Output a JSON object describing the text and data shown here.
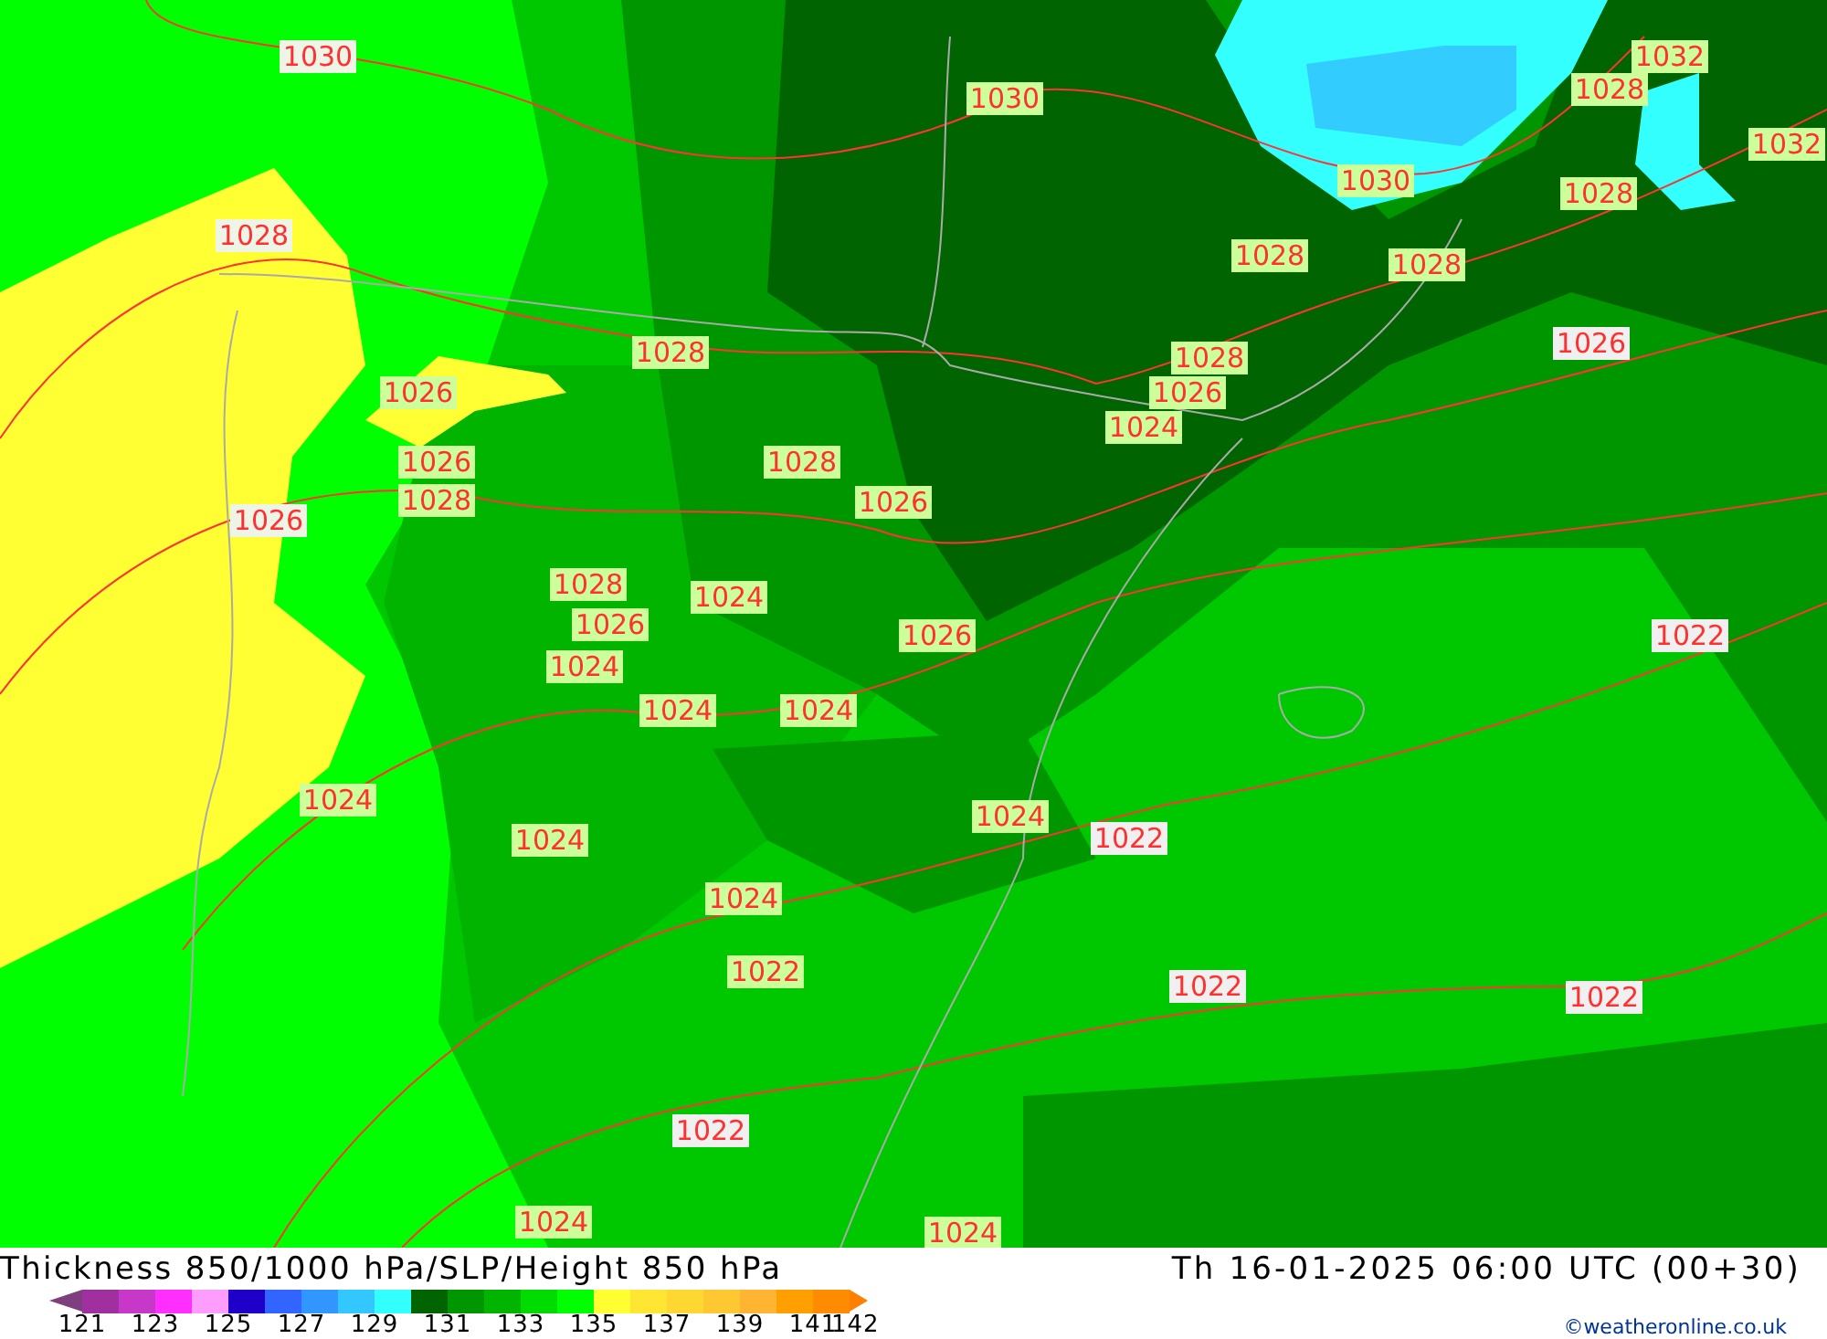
{
  "map": {
    "isobar_labels": [
      {
        "text": "1030",
        "color": "#eef5e6"
      },
      {
        "text": "1030",
        "color": "#ccff99"
      },
      {
        "text": "1032",
        "color": "#ccff99"
      },
      {
        "text": "1028",
        "color": "#ccff99"
      },
      {
        "text": "1032",
        "color": "#ccff99"
      },
      {
        "text": "1030",
        "color": "#ccff99"
      },
      {
        "text": "1028",
        "color": "#ccff99"
      },
      {
        "text": "1028",
        "color": "#ccff99"
      },
      {
        "text": "1028",
        "color": "#ccff99"
      },
      {
        "text": "1028",
        "color": "#eef5e6"
      },
      {
        "text": "1026",
        "color": "#f0f0f0"
      },
      {
        "text": "1028",
        "color": "#ccff99"
      },
      {
        "text": "1026",
        "color": "#ccff99"
      },
      {
        "text": "1028",
        "color": "#ccff99"
      },
      {
        "text": "1026",
        "color": "#ccff99"
      },
      {
        "text": "1024",
        "color": "#ccff99"
      },
      {
        "text": "1026",
        "color": "#ccff99"
      },
      {
        "text": "1028",
        "color": "#ccff99"
      },
      {
        "text": "1028",
        "color": "#ccff99"
      },
      {
        "text": "1026",
        "color": "#ccff99"
      },
      {
        "text": "1026",
        "color": "#eef5e6"
      },
      {
        "text": "1028",
        "color": "#ccff99"
      },
      {
        "text": "1024",
        "color": "#ccff99"
      },
      {
        "text": "1026",
        "color": "#ccff99"
      },
      {
        "text": "1024",
        "color": "#ccff99"
      },
      {
        "text": "1026",
        "color": "#ccff99"
      },
      {
        "text": "1022",
        "color": "#f0f0f0"
      },
      {
        "text": "1024",
        "color": "#ccff99"
      },
      {
        "text": "1024",
        "color": "#ccff99"
      },
      {
        "text": "1024",
        "color": "#ccff99"
      },
      {
        "text": "1024",
        "color": "#ccff99"
      },
      {
        "text": "1022",
        "color": "#f0f0f0"
      },
      {
        "text": "1024",
        "color": "#ccff99"
      },
      {
        "text": "1024",
        "color": "#ccff99"
      },
      {
        "text": "1022",
        "color": "#ccff99"
      },
      {
        "text": "1022",
        "color": "#f0f0f0"
      },
      {
        "text": "1022",
        "color": "#f0f0f0"
      },
      {
        "text": "1022",
        "color": "#f0f0f0"
      },
      {
        "text": "1024",
        "color": "#ccff99"
      },
      {
        "text": "1024",
        "color": "#ccff99"
      }
    ]
  },
  "footer": {
    "title": "Thickness 850/1000 hPa/SLP/Height 850 hPa",
    "valid_time": "Th 16-01-2025 06:00 UTC (00+30)",
    "legend": {
      "swatches": [
        {
          "color": "#7f3f7f"
        },
        {
          "color": "#a030a0"
        },
        {
          "color": "#c838c8"
        },
        {
          "color": "#ff30ff"
        },
        {
          "color": "#ff9cff"
        },
        {
          "color": "#1e00c8"
        },
        {
          "color": "#3264ff"
        },
        {
          "color": "#3296ff"
        },
        {
          "color": "#32c8ff"
        },
        {
          "color": "#32ffff"
        },
        {
          "color": "#006400"
        },
        {
          "color": "#009600"
        },
        {
          "color": "#00b400"
        },
        {
          "color": "#00dc00"
        },
        {
          "color": "#00ff00"
        },
        {
          "color": "#ffff32"
        },
        {
          "color": "#ffe632"
        },
        {
          "color": "#ffd732"
        },
        {
          "color": "#ffc832"
        },
        {
          "color": "#ffb432"
        },
        {
          "color": "#ffa000"
        },
        {
          "color": "#ff8c00"
        },
        {
          "color": "#ff8000"
        }
      ],
      "ticks": [
        "121",
        "123",
        "125",
        "127",
        "129",
        "131",
        "133",
        "135",
        "137",
        "139",
        "141",
        "142"
      ]
    },
    "credit": "©weatheronline.co.uk"
  }
}
